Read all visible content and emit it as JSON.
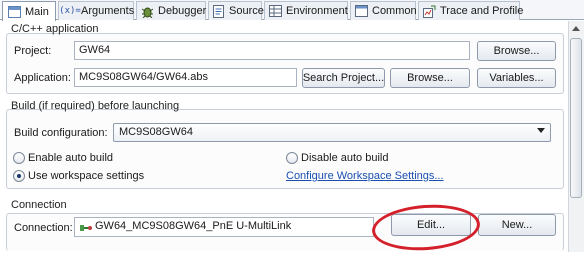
{
  "tabs": [
    {
      "label": "Main",
      "icon": "main-tab-icon",
      "active": true
    },
    {
      "label": "Arguments",
      "icon": "arguments-icon"
    },
    {
      "label": "Debugger",
      "icon": "debugger-icon"
    },
    {
      "label": "Source",
      "icon": "source-icon"
    },
    {
      "label": "Environment",
      "icon": "environment-icon"
    },
    {
      "label": "Common",
      "icon": "common-icon"
    },
    {
      "label": "Trace and Profile",
      "icon": "trace-profile-icon"
    }
  ],
  "app_group": {
    "title": "C/C++ application",
    "project_label": "Project:",
    "project_value": "GW64",
    "project_browse": "Browse...",
    "application_label": "Application:",
    "application_value": "MC9S08GW64/GW64.abs",
    "search_project": "Search Project...",
    "application_browse": "Browse...",
    "variables": "Variables..."
  },
  "build_group": {
    "title": "Build (if required) before launching",
    "config_label": "Build configuration:",
    "config_value": "MC9S08GW64",
    "enable_auto": "Enable auto build",
    "disable_auto": "Disable auto build",
    "use_workspace": "Use workspace settings",
    "configure_link": "Configure Workspace Settings...",
    "selected_option": "Use workspace settings"
  },
  "connection_group": {
    "title": "Connection",
    "label": "Connection:",
    "value": "GW64_MC9S08GW64_PnE U-MultiLink",
    "edit": "Edit...",
    "new": "New..."
  },
  "colors": {
    "highlight": "#d4202a",
    "link": "#1a4fb0"
  }
}
